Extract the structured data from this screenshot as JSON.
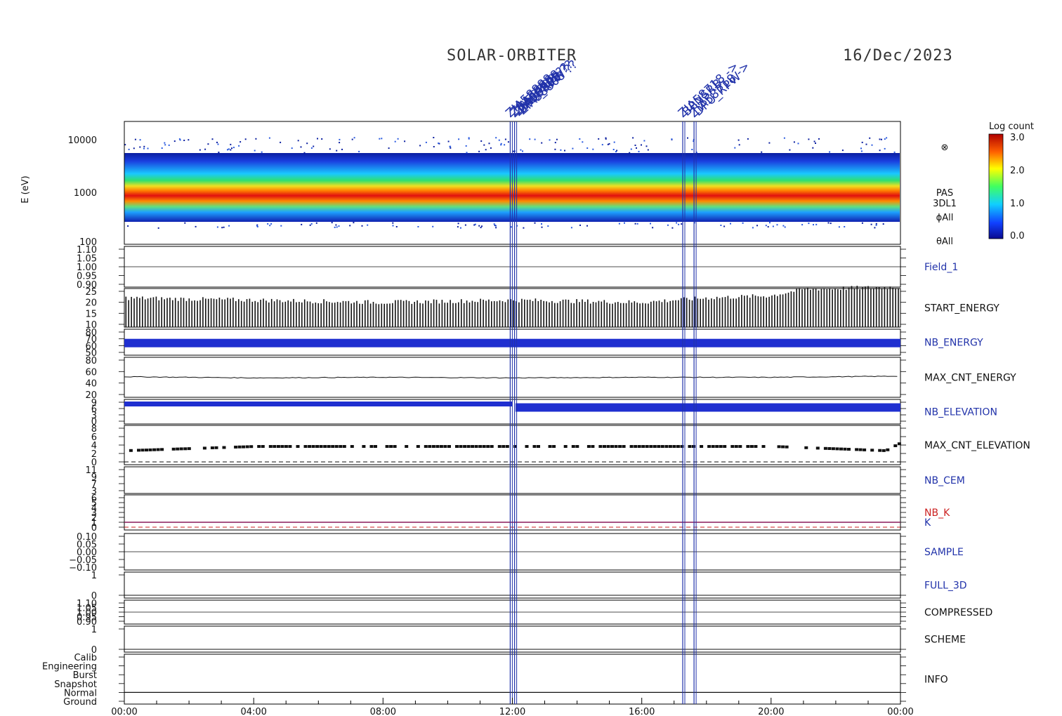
{
  "header": {
    "mission": "SOLAR-ORBITER",
    "date": "16/Dec/2023"
  },
  "event_annotations": [
    {
      "time": "11:56",
      "labels": [
        "ZIA58888",
        "Z1A58808",
        "ZIA58808 ?? ",
        "DPU_RPW"
      ]
    },
    {
      "time": "12:04",
      "labels": [
        "ZIA58708 ??",
        "ZIA58808",
        "ZIA58808 ??"
      ]
    },
    {
      "time": "17:16",
      "labels": [
        "ZIA58718 ->",
        "BPNSRB"
      ]
    },
    {
      "time": "17:37",
      "labels": [
        "ZIA58718 ->",
        "DPU_RPW"
      ]
    }
  ],
  "spectrogram": {
    "ylabel": "E (eV)",
    "y_ticks": [
      "10000",
      "1000",
      "100"
    ],
    "colorbar_title": "Log count",
    "colorbar_ticks": [
      "3.0",
      "2.0",
      "1.0",
      "0.0"
    ],
    "side_labels": [
      "PAS",
      "3DL1",
      "ϕAll",
      "θAll"
    ]
  },
  "panels": [
    {
      "key": "field1",
      "label": "Field_1",
      "color": "blue",
      "ticks": [
        "1.10",
        "1.05",
        "1.00",
        "0.95",
        "0.90"
      ]
    },
    {
      "key": "start_energy",
      "label": "START_ENERGY",
      "color": "black",
      "ticks": [
        "25",
        "20",
        "15",
        "10"
      ]
    },
    {
      "key": "nb_energy",
      "label": "NB_ENERGY",
      "color": "blue",
      "ticks": [
        "80",
        "70",
        "60",
        "50"
      ]
    },
    {
      "key": "max_cnt_energy",
      "label": "MAX_CNT_ENERGY",
      "color": "black",
      "ticks": [
        "80",
        "60",
        "40",
        "20"
      ]
    },
    {
      "key": "nb_elevation",
      "label": "NB_ELEVATION",
      "color": "blue",
      "ticks": [
        "9",
        "6",
        "3",
        "0"
      ]
    },
    {
      "key": "max_cnt_elevation",
      "label": "MAX_CNT_ELEVATION",
      "color": "black",
      "ticks": [
        "8",
        "6",
        "4",
        "2",
        "0"
      ]
    },
    {
      "key": "nb_cem",
      "label": "NB_CEM",
      "color": "blue",
      "ticks": [
        "11",
        "9",
        "7",
        "3"
      ]
    },
    {
      "key": "nb_k",
      "label": "NB_K",
      "label2": "K",
      "color": "red",
      "ticks": [
        "6",
        "5",
        "4",
        "3",
        "2",
        "1",
        "0"
      ]
    },
    {
      "key": "sample",
      "label": "SAMPLE",
      "color": "blue",
      "ticks": [
        "0.10",
        "0.05",
        "0.00",
        "−0.05",
        "−0.10"
      ]
    },
    {
      "key": "full_3d",
      "label": "FULL_3D",
      "color": "blue",
      "ticks": [
        "1",
        "0"
      ]
    },
    {
      "key": "compressed",
      "label": "COMPRESSED",
      "color": "black",
      "ticks": [
        "1.10",
        "1.05",
        "1.00",
        "0.95",
        "0.90"
      ]
    },
    {
      "key": "scheme",
      "label": "SCHEME",
      "color": "black",
      "ticks": [
        "1",
        "0"
      ]
    },
    {
      "key": "info",
      "label": "INFO",
      "color": "black",
      "ticks": [
        "Calib",
        "Engineering",
        "Burst",
        "Snapshot",
        "Normal",
        "Ground"
      ]
    }
  ],
  "x_ticks": [
    "00:00",
    "04:00",
    "08:00",
    "12:00",
    "16:00",
    "20:00",
    "00:00"
  ],
  "chart_data": {
    "type": "heatmap",
    "xlabel": "",
    "ylabel": "E (eV)",
    "x_range": [
      "00:00",
      "24:00"
    ],
    "ylim": [
      100,
      15000
    ],
    "y_scale": "log",
    "colorbar": {
      "title": "Log count",
      "range": [
        0.0,
        3.0
      ]
    },
    "peak_energy_eV": {
      "time_hours": [
        0,
        4,
        8,
        12,
        16,
        20,
        22,
        24
      ],
      "values": [
        950,
        1000,
        1000,
        950,
        950,
        900,
        780,
        800
      ]
    },
    "series": [
      {
        "name": "START_ENERGY",
        "time_hours": [
          0,
          4,
          8,
          12,
          16,
          18,
          20,
          21,
          24
        ],
        "values": [
          22,
          21,
          20,
          21,
          20,
          22,
          23,
          26,
          27
        ]
      },
      {
        "name": "MAX_CNT_ENERGY",
        "time_hours": [
          0,
          4,
          8,
          12,
          16,
          20,
          24
        ],
        "values": [
          51,
          49,
          50,
          49,
          50,
          50,
          52
        ]
      },
      {
        "name": "NB_ENERGY",
        "time_hours": [
          0,
          24
        ],
        "values": [
          64,
          64
        ]
      },
      {
        "name": "NB_ELEVATION",
        "time_hours": [
          0,
          12,
          12.1,
          24
        ],
        "values": [
          9,
          9,
          7,
          7
        ]
      },
      {
        "name": "MAX_CNT_ELEVATION",
        "time_hours": [
          0,
          4,
          8,
          12,
          16,
          20,
          23.5,
          24
        ],
        "values": [
          3,
          4,
          4,
          4,
          4,
          4,
          3,
          5
        ]
      },
      {
        "name": "K",
        "time_hours": [
          0,
          24
        ],
        "values": [
          1,
          1
        ]
      }
    ]
  }
}
